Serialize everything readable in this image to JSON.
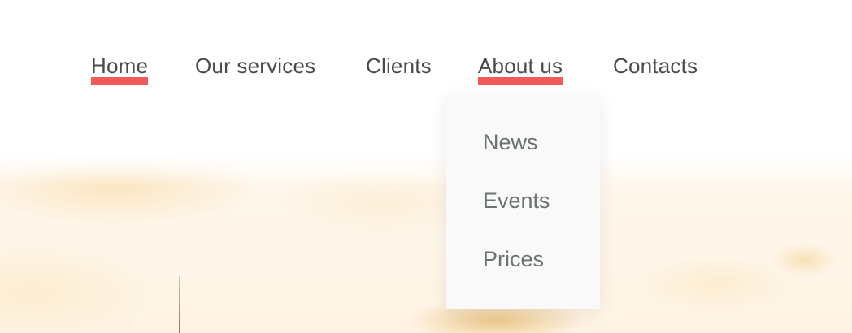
{
  "nav": {
    "items": [
      {
        "label": "Home",
        "active": true
      },
      {
        "label": "Our services",
        "active": false
      },
      {
        "label": "Clients",
        "active": false
      },
      {
        "label": "About us",
        "active": true
      },
      {
        "label": "Contacts",
        "active": false
      }
    ]
  },
  "dropdown": {
    "parent": "About us",
    "items": [
      {
        "label": "News"
      },
      {
        "label": "Events"
      },
      {
        "label": "Prices"
      }
    ]
  },
  "colors": {
    "accent": "#f25a5a",
    "nav_text": "#4b4b4b",
    "dropdown_text": "#6b7272",
    "dropdown_bg": "#f9f9f9"
  }
}
